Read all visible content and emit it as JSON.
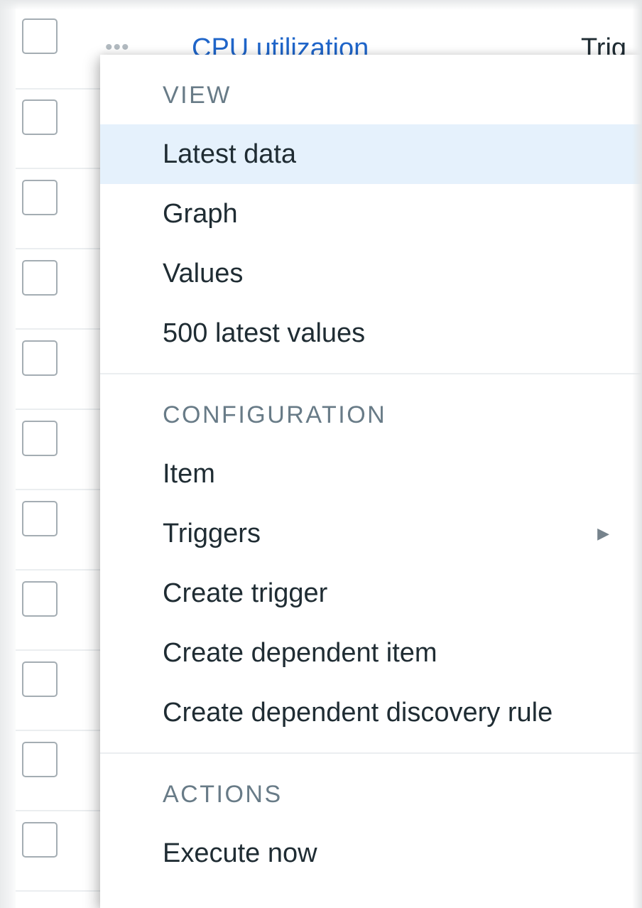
{
  "table": {
    "first_row": {
      "actions_glyph": "•••",
      "name": "CPU utilization",
      "type_fragment": "Trig"
    },
    "row_count": 11
  },
  "menu": {
    "sections": [
      {
        "title": "VIEW",
        "items": [
          {
            "label": "Latest data",
            "active": true
          },
          {
            "label": "Graph"
          },
          {
            "label": "Values"
          },
          {
            "label": "500 latest values"
          }
        ]
      },
      {
        "title": "CONFIGURATION",
        "items": [
          {
            "label": "Item"
          },
          {
            "label": "Triggers",
            "submenu": true
          },
          {
            "label": "Create trigger"
          },
          {
            "label": "Create dependent item"
          },
          {
            "label": "Create dependent discovery rule"
          }
        ]
      },
      {
        "title": "ACTIONS",
        "items": [
          {
            "label": "Execute now"
          }
        ]
      }
    ],
    "submenu_icon": "triangle-right-icon"
  },
  "colors": {
    "link": "#1f65c9",
    "active_item_bg": "#e5f1fc",
    "section_header": "#687b87",
    "text": "#1f2c33",
    "checkbox_border": "#a4adb3"
  }
}
